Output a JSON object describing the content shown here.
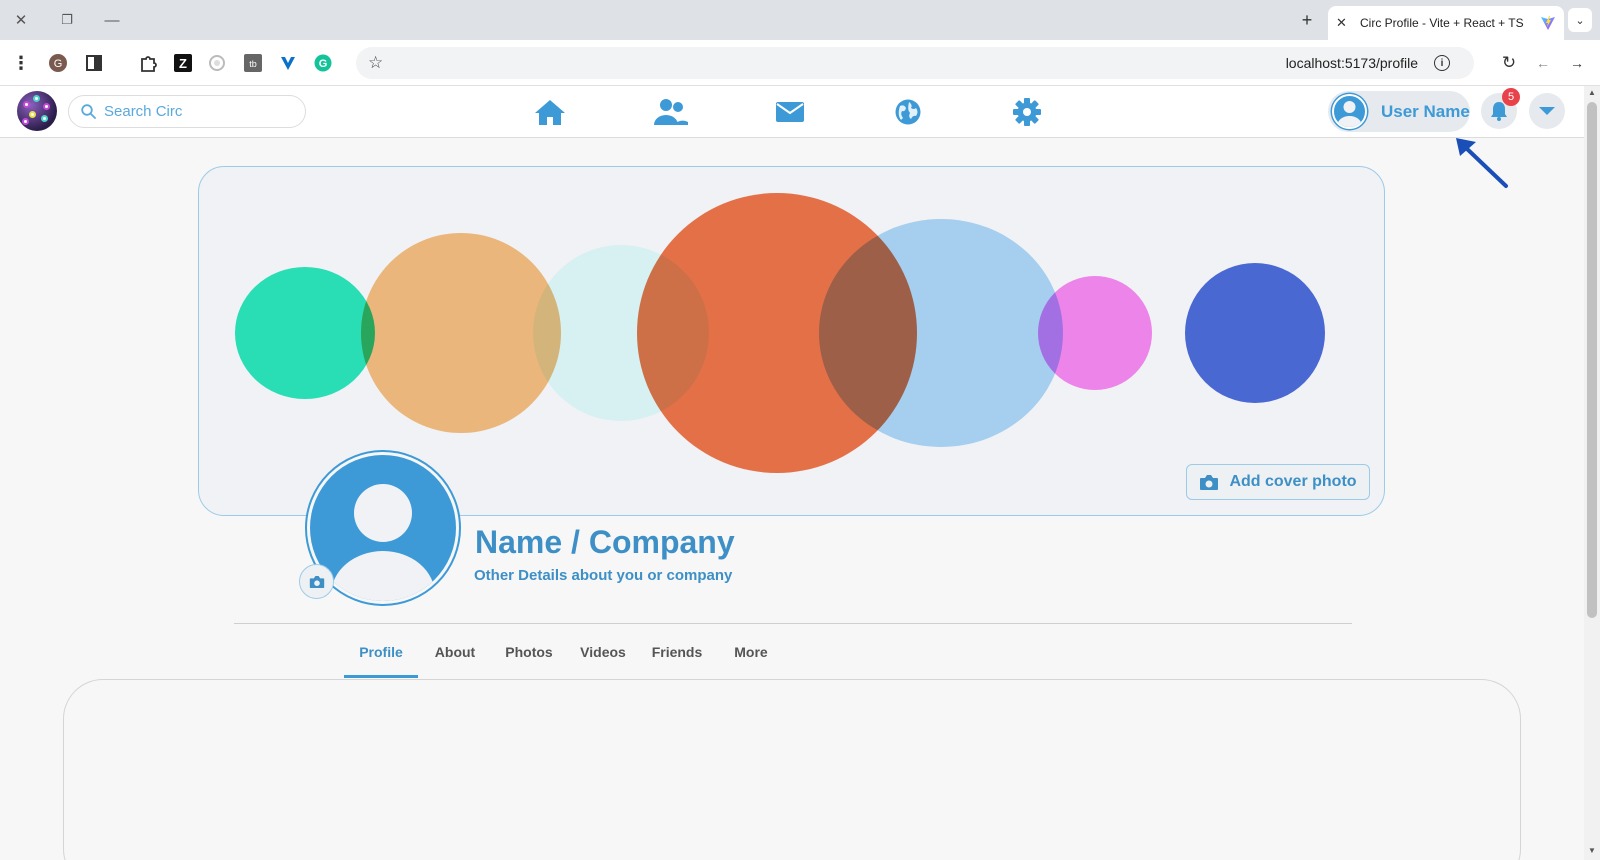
{
  "browser": {
    "tab_title": "Circ Profile - Vite + React + TS",
    "url": "localhost:5173/profile"
  },
  "header": {
    "search_placeholder": "Search Circ",
    "user_name": "User Name",
    "notification_count": "5",
    "accent_color": "#3d9ad7"
  },
  "profile": {
    "name": "Name / Company",
    "details": "Other Details about you or company",
    "add_cover_label": "Add cover photo",
    "tabs": [
      {
        "label": "Profile",
        "active": true
      },
      {
        "label": "About",
        "active": false
      },
      {
        "label": "Photos",
        "active": false
      },
      {
        "label": "Videos",
        "active": false
      },
      {
        "label": "Friends",
        "active": false
      },
      {
        "label": "More",
        "active": false
      }
    ]
  },
  "cover_colors": [
    "#20e8b9",
    "#f9b56b",
    "#e4fdfb",
    "#f26737",
    "#9ccff7",
    "#fb85f2",
    "#4466d9"
  ]
}
